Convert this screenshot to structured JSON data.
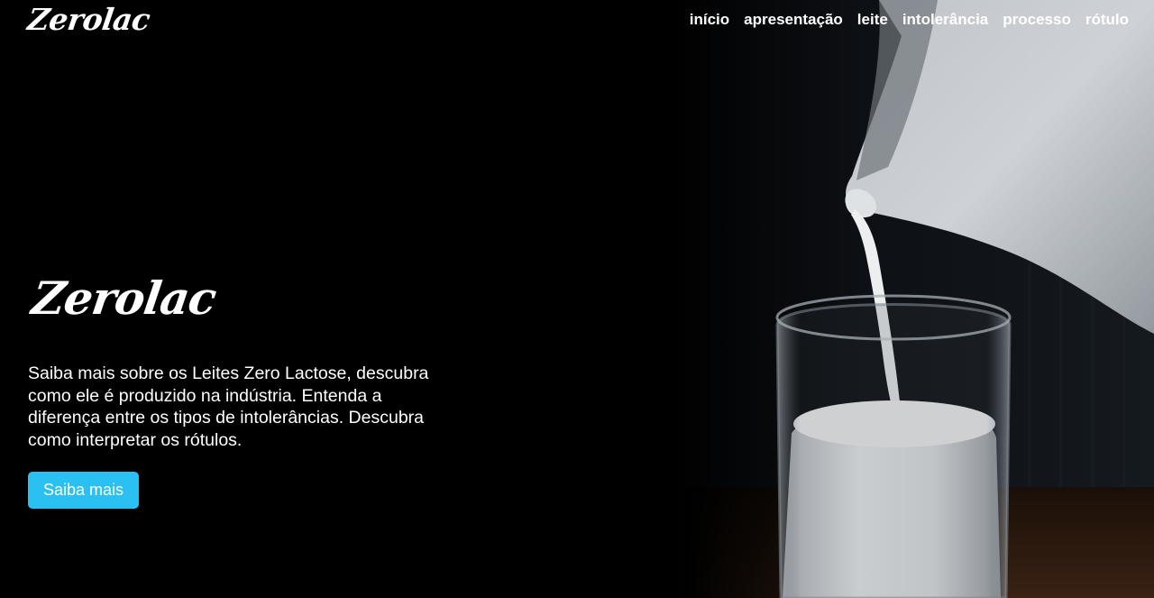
{
  "navbar": {
    "brand": "Zerolac",
    "links": [
      "início",
      "apresentação",
      "leite",
      "intolerância",
      "processo",
      "rótulo"
    ]
  },
  "hero": {
    "title": "Zerolac",
    "text": "Saiba mais sobre os Leites Zero Lactose, descubra como ele é produzido na indústria. Entenda a diferença entre os tipos de intolerâncias. Descubra como interpretar os rótulos.",
    "button_label": "Saiba mais"
  },
  "colors": {
    "background": "#000000",
    "accent": "#2bc0f2",
    "text": "#ffffff"
  }
}
